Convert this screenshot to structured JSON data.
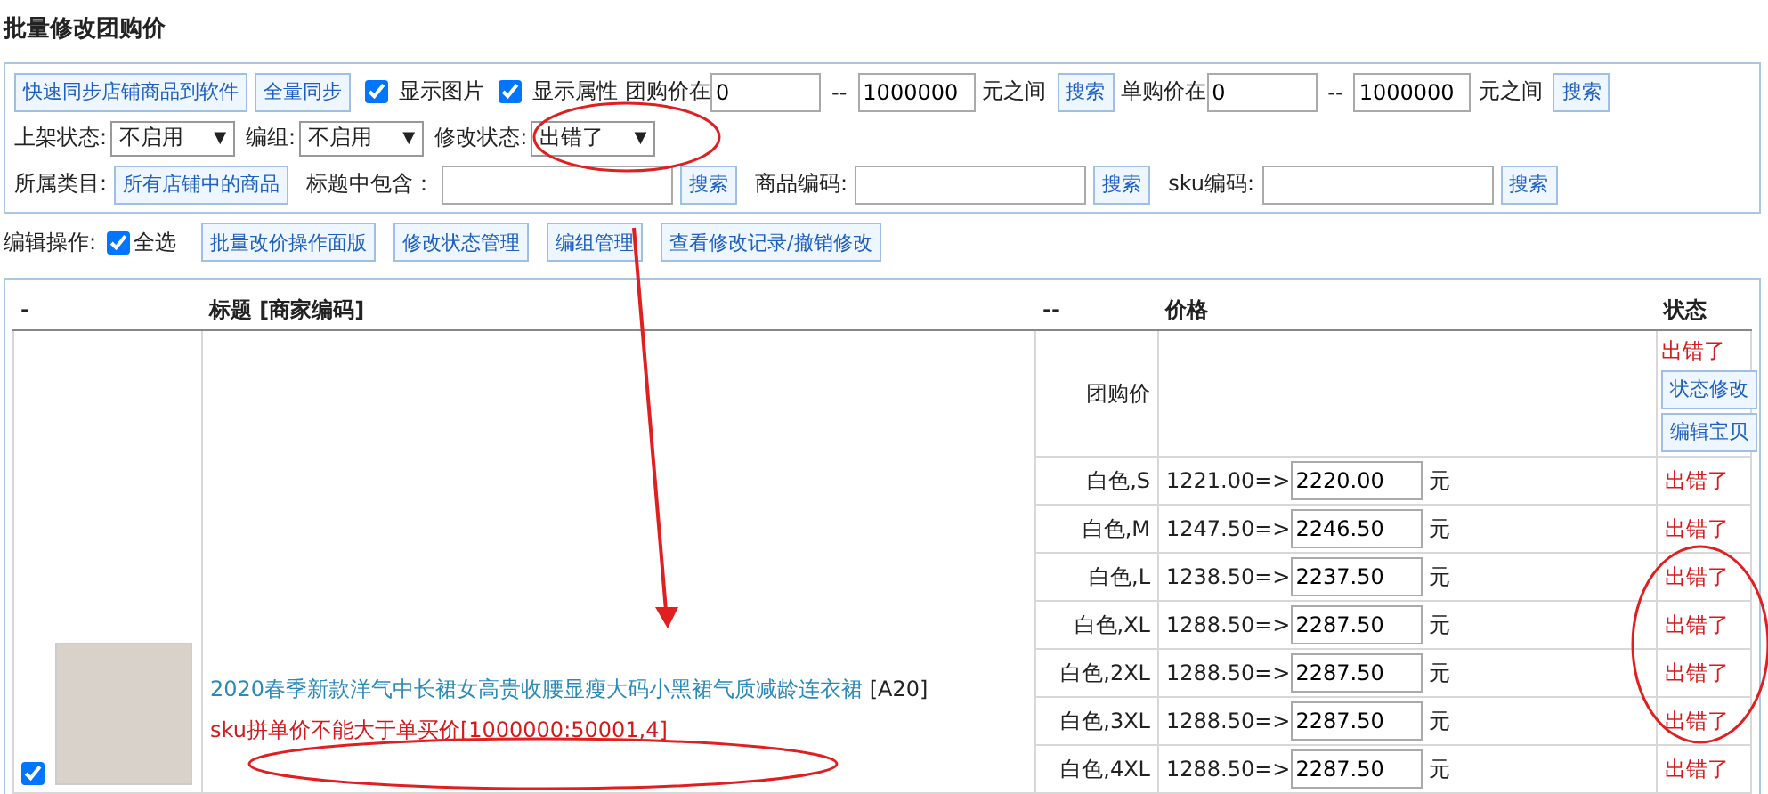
{
  "page_title": "批量修改团购价",
  "filter_row1": {
    "sync_button": "快速同步店铺商品到软件",
    "full_sync_button": "全量同步",
    "checkboxes": [
      {
        "label": "显示图片",
        "checked": true
      },
      {
        "label": "显示属性",
        "checked": true
      }
    ],
    "price_ranges": [
      {
        "label": "团购价在",
        "min": "0",
        "separator": "--",
        "max": "1000000",
        "unit": "元之间",
        "button": "搜索"
      },
      {
        "label": "单购价在",
        "min": "0",
        "separator": "--",
        "max": "1000000",
        "unit": "元之间",
        "button": "搜索"
      }
    ]
  },
  "filter_row2": {
    "selects": [
      {
        "label": "上架状态:",
        "value": "不启用",
        "arrow": "▼"
      },
      {
        "label": "编组:",
        "value": "不启用",
        "arrow": "▼"
      },
      {
        "label": "修改状态:",
        "value": "出错了",
        "arrow": "▼"
      }
    ]
  },
  "filter_row3": {
    "category_label": "所属类目:",
    "category_button": "所有店铺中的商品",
    "text_filters": [
      {
        "label": "标题中包含：",
        "button": "搜索"
      },
      {
        "label": "商品编码:",
        "button": "搜索"
      },
      {
        "label": "sku编码:",
        "button": "搜索"
      }
    ]
  },
  "edit_ops": {
    "label": "编辑操作:",
    "select_all": {
      "label": "全选",
      "checked": true
    },
    "buttons": [
      "批量改价操作面版",
      "修改状态管理",
      "编组管理",
      "查看修改记录/撤销修改"
    ]
  },
  "table": {
    "columns": [
      "-",
      "标题 [商家编码]",
      "--",
      "价格",
      "状态"
    ],
    "product": {
      "checked": true,
      "title": "2020春季新款洋气中长裙女高贵收腰显瘦大码小黑裙气质减龄连衣裙",
      "code": "[A20]",
      "error": "sku拼单价不能大于单买价[1000000:50001,4]",
      "group_row": {
        "label": "团购价",
        "status": "出错了",
        "buttons": [
          "状态修改",
          "编辑宝贝"
        ]
      },
      "skus": [
        {
          "name": "白色,S",
          "old_price": "1221.00=>",
          "new_price": "2220.00",
          "unit": "元",
          "status": "出错了"
        },
        {
          "name": "白色,M",
          "old_price": "1247.50=>",
          "new_price": "2246.50",
          "unit": "元",
          "status": "出错了"
        },
        {
          "name": "白色,L",
          "old_price": "1238.50=>",
          "new_price": "2237.50",
          "unit": "元",
          "status": "出错了"
        },
        {
          "name": "白色,XL",
          "old_price": "1288.50=>",
          "new_price": "2287.50",
          "unit": "元",
          "status": "出错了"
        },
        {
          "name": "白色,2XL",
          "old_price": "1288.50=>",
          "new_price": "2287.50",
          "unit": "元",
          "status": "出错了"
        },
        {
          "name": "白色,3XL",
          "old_price": "1288.50=>",
          "new_price": "2287.50",
          "unit": "元",
          "status": "出错了"
        },
        {
          "name": "白色,4XL",
          "old_price": "1288.50=>",
          "new_price": "2287.50",
          "unit": "元",
          "status": "出错了"
        }
      ]
    }
  }
}
